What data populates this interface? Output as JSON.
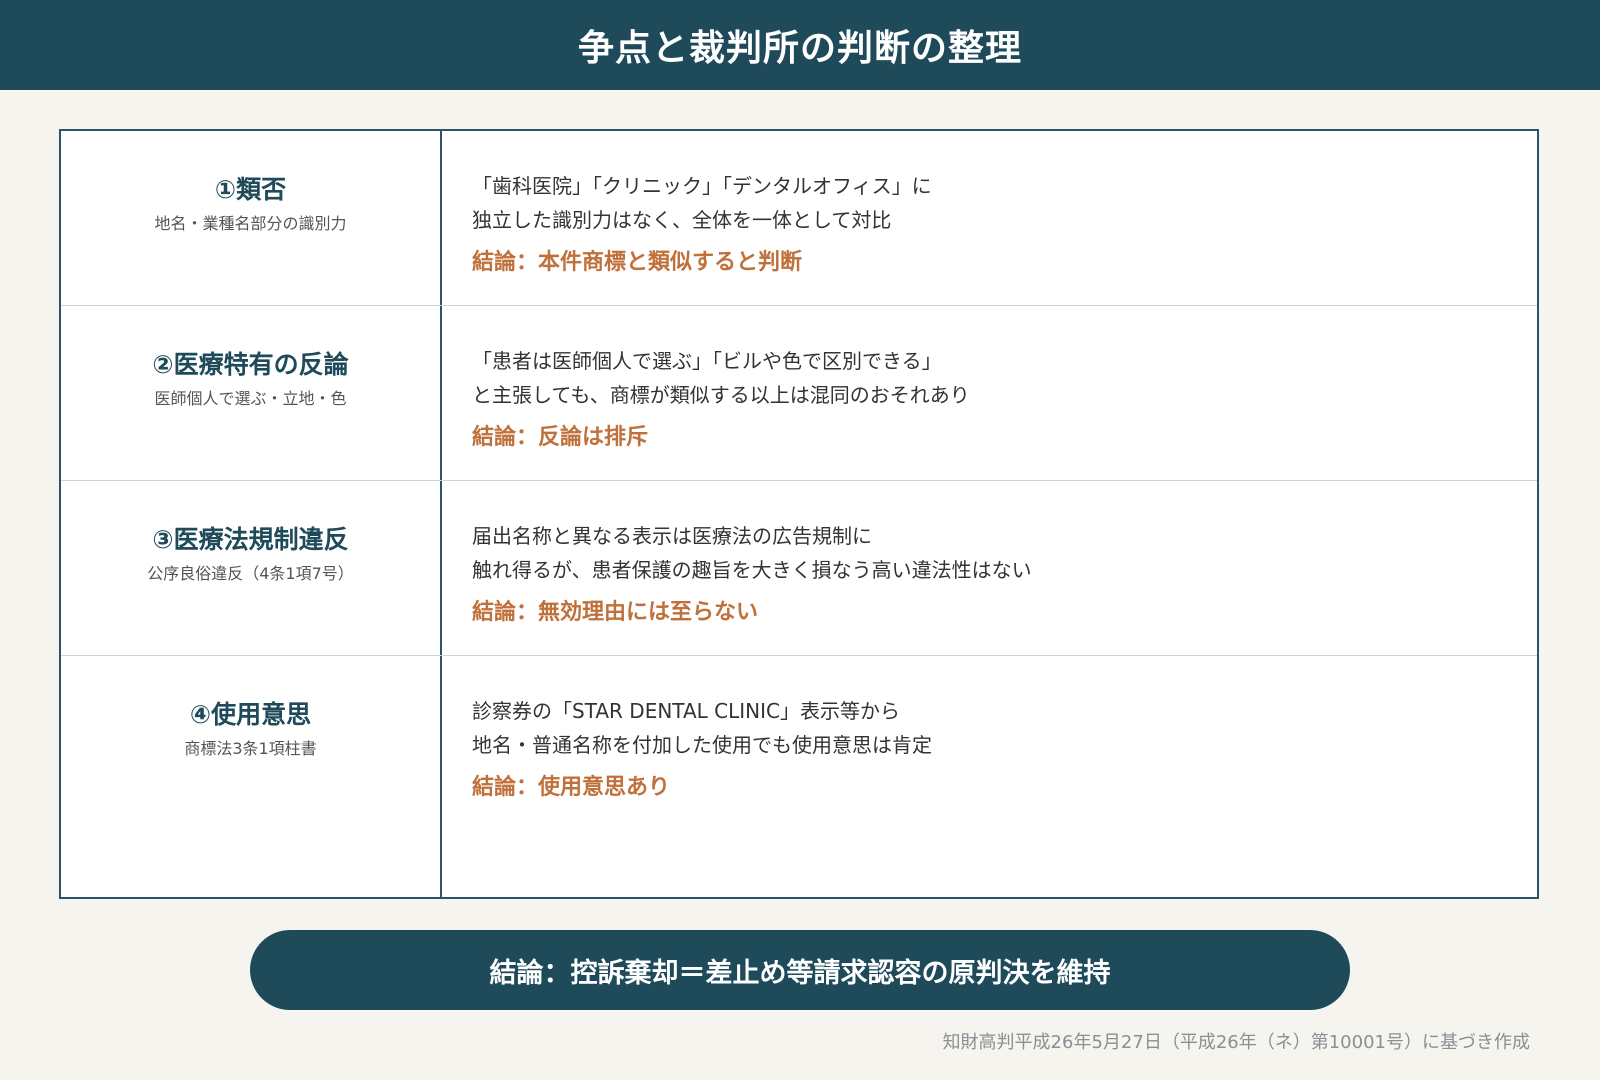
{
  "header": {
    "title": "争点と裁判所の判断の整理"
  },
  "issues": [
    {
      "title": "①類否",
      "subtitle": "地名・業種名部分の識別力",
      "description": [
        "「歯科医院」「クリニック」「デンタルオフィス」に",
        "独立した識別力はなく、全体を一体として対比"
      ],
      "conclusion": "結論：本件商標と類似すると判断"
    },
    {
      "title": "②医療特有の反論",
      "subtitle": "医師個人で選ぶ・立地・色",
      "description": [
        "「患者は医師個人で選ぶ」「ビルや色で区別できる」",
        "と主張しても、商標が類似する以上は混同のおそれあり"
      ],
      "conclusion": "結論：反論は排斥"
    },
    {
      "title": "③医療法規制違反",
      "subtitle": "公序良俗違反（4条1項7号）",
      "description": [
        "届出名称と異なる表示は医療法の広告規制に",
        "触れ得るが、患者保護の趣旨を大きく損なう高い違法性はない"
      ],
      "conclusion": "結論：無効理由には至らない"
    },
    {
      "title": "④使用意思",
      "subtitle": "商標法3条1項柱書",
      "description": [
        "診察券の「STAR DENTAL CLINIC」表示等から",
        "地名・普通名称を付加した使用でも使用意思は肯定"
      ],
      "conclusion": "結論：使用意思あり"
    }
  ],
  "verdict": {
    "text": "結論：控訴棄却＝差止め等請求認容の原判決を維持"
  },
  "source": {
    "text": "知財高判平成26年5月27日（平成26年（ネ）第10001号）に基づき作成"
  },
  "colors": {
    "header_bg": "#1e4a5a",
    "accent": "#c0703a",
    "page_bg": "#f6f4ef"
  }
}
